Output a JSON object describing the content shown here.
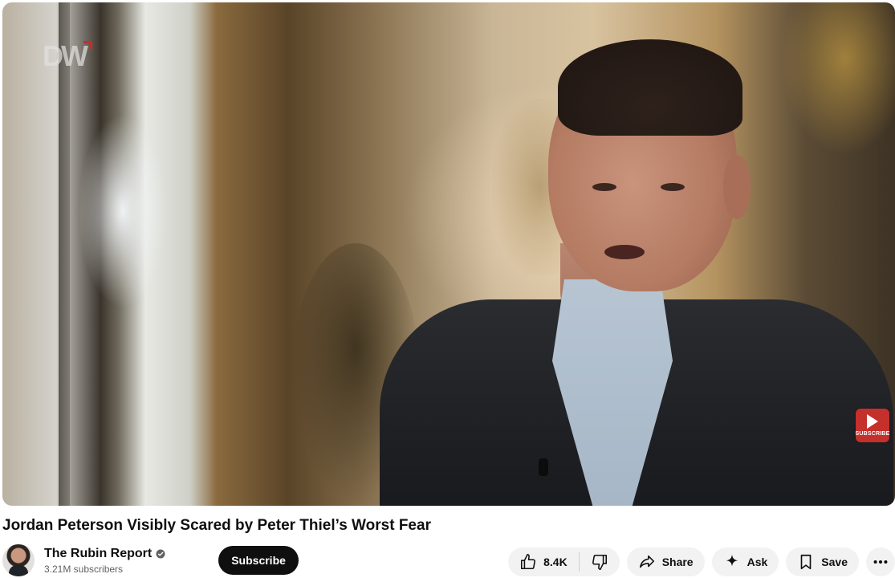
{
  "video": {
    "watermark_logo": "DW",
    "subscribe_watermark": "SUBSCRIBE"
  },
  "title": "Jordan Peterson Visibly Scared by Peter Thiel’s Worst Fear",
  "channel": {
    "name": "The Rubin Report",
    "subscribers": "3.21M subscribers",
    "verified_icon": "verified-check-icon",
    "subscribe_label": "Subscribe"
  },
  "actions": {
    "like_count": "8.4K",
    "like_icon": "thumbs-up-icon",
    "dislike_icon": "thumbs-down-icon",
    "share_label": "Share",
    "share_icon": "share-arrow-icon",
    "ask_label": "Ask",
    "ask_icon": "sparkle-icon",
    "save_label": "Save",
    "save_icon": "bookmark-icon",
    "more_icon": "more-horizontal-icon"
  },
  "colors": {
    "subscribe_bg": "#0f0f0f",
    "pill_bg": "#f2f2f2",
    "subscribe_watermark_red": "#c4302b"
  }
}
